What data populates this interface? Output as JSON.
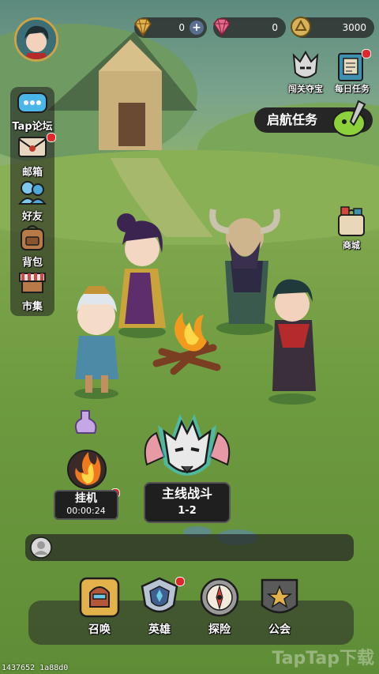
{
  "resources": {
    "diamond": {
      "icon": "gold-diamond-icon",
      "value": "0"
    },
    "pink_gem": {
      "icon": "pink-gem-icon",
      "value": "0"
    },
    "coin": {
      "icon": "coin-icon",
      "value": "3000"
    }
  },
  "left_menu": [
    {
      "id": "tap-forum",
      "icon": "chat-bubble-icon",
      "label": "Tap论坛",
      "badge": false
    },
    {
      "id": "mailbox",
      "icon": "mail-icon",
      "label": "邮箱",
      "badge": true
    },
    {
      "id": "friends",
      "icon": "friends-icon",
      "label": "好友",
      "badge": false
    },
    {
      "id": "backpack",
      "icon": "backpack-icon",
      "label": "背包",
      "badge": false
    },
    {
      "id": "market",
      "icon": "market-stall-icon",
      "label": "市集",
      "badge": false
    }
  ],
  "right_menu": [
    {
      "id": "stage-treasure",
      "icon": "wolf-helmet-icon",
      "label": "闯关夺宝",
      "badge": false
    },
    {
      "id": "daily-tasks",
      "icon": "task-book-icon",
      "label": "每日任务",
      "badge": true
    },
    {
      "id": "shop",
      "icon": "shop-bag-icon",
      "label": "商城",
      "badge": false
    }
  ],
  "quest_banner": {
    "label": "启航任务",
    "icon": "slime-sword-icon"
  },
  "idle": {
    "label": "挂机",
    "timer": "00:00:24",
    "icon": "flame-icon"
  },
  "main_battle": {
    "label": "主线战斗",
    "stage": "1-2",
    "icon": "wolf-mask-icon"
  },
  "chat": {
    "icon": "user-avatar-icon",
    "text": ""
  },
  "bottom_nav": [
    {
      "id": "summon",
      "icon": "summon-helmet-icon",
      "label": "召唤",
      "badge": false
    },
    {
      "id": "heroes",
      "icon": "hero-shield-icon",
      "label": "英雄",
      "badge": true
    },
    {
      "id": "explore",
      "icon": "compass-icon",
      "label": "探险",
      "badge": false
    },
    {
      "id": "guild",
      "icon": "guild-star-icon",
      "label": "公会",
      "badge": false
    }
  ],
  "footer_id": "1437652 1a88d0",
  "watermark": "TapTap下载",
  "colors": {
    "badge": "#e3262b",
    "grass": "#7ea54c",
    "panel": "#262626",
    "gold": "#e3b24a"
  }
}
